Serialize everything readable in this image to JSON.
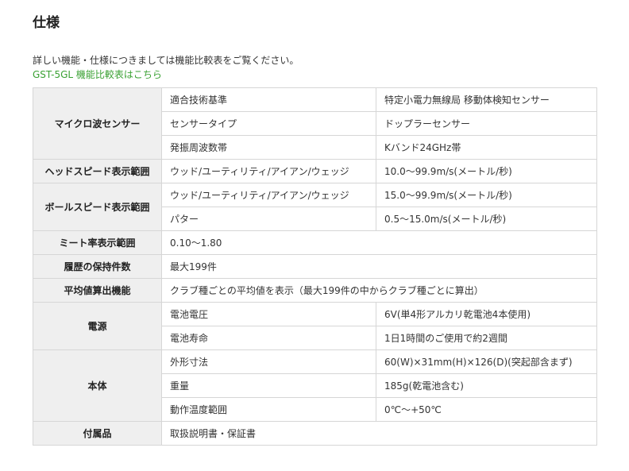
{
  "page": {
    "title": "仕様",
    "description": "詳しい機能・仕様につきましては機能比較表をご覧ください。",
    "link_text": "GST-5GL 機能比較表はこちら",
    "colors": {
      "link": "#3aa133",
      "header_bg": "#efefef",
      "border": "#d6d6d6"
    }
  },
  "spec": {
    "microwave": {
      "label": "マイクロ波センサー",
      "rows": [
        {
          "item": "適合技術基準",
          "value": "特定小電力無線局 移動体検知センサー"
        },
        {
          "item": "センサータイプ",
          "value": "ドップラーセンサー"
        },
        {
          "item": "発振周波数帯",
          "value": "Kバンド24GHz帯"
        }
      ]
    },
    "head_speed": {
      "label": "ヘッドスピード表示範囲",
      "rows": [
        {
          "item": "ウッド/ユーティリティ/アイアン/ウェッジ",
          "value": "10.0〜99.9m/s(メートル/秒)"
        }
      ]
    },
    "ball_speed": {
      "label": "ボールスピード表示範囲",
      "rows": [
        {
          "item": "ウッド/ユーティリティ/アイアン/ウェッジ",
          "value": "15.0〜99.9m/s(メートル/秒)"
        },
        {
          "item": "パター",
          "value": "0.5〜15.0m/s(メートル/秒)"
        }
      ]
    },
    "meet_rate": {
      "label": "ミート率表示範囲",
      "value": "0.10〜1.80"
    },
    "history": {
      "label": "履歴の保持件数",
      "value": "最大199件"
    },
    "average": {
      "label": "平均値算出機能",
      "value": "クラブ種ごとの平均値を表示（最大199件の中からクラブ種ごとに算出）"
    },
    "power": {
      "label": "電源",
      "rows": [
        {
          "item": "電池電圧",
          "value": "6V(単4形アルカリ乾電池4本使用)"
        },
        {
          "item": "電池寿命",
          "value": "1日1時間のご使用で約2週間"
        }
      ]
    },
    "body": {
      "label": "本体",
      "rows": [
        {
          "item": "外形寸法",
          "value": "60(W)×31mm(H)×126(D)(突起部含まず)"
        },
        {
          "item": "重量",
          "value": "185g(乾電池含む)"
        },
        {
          "item": "動作温度範囲",
          "value": "0℃〜+50℃"
        }
      ]
    },
    "accessories": {
      "label": "付属品",
      "value": "取扱説明書・保証書"
    }
  }
}
